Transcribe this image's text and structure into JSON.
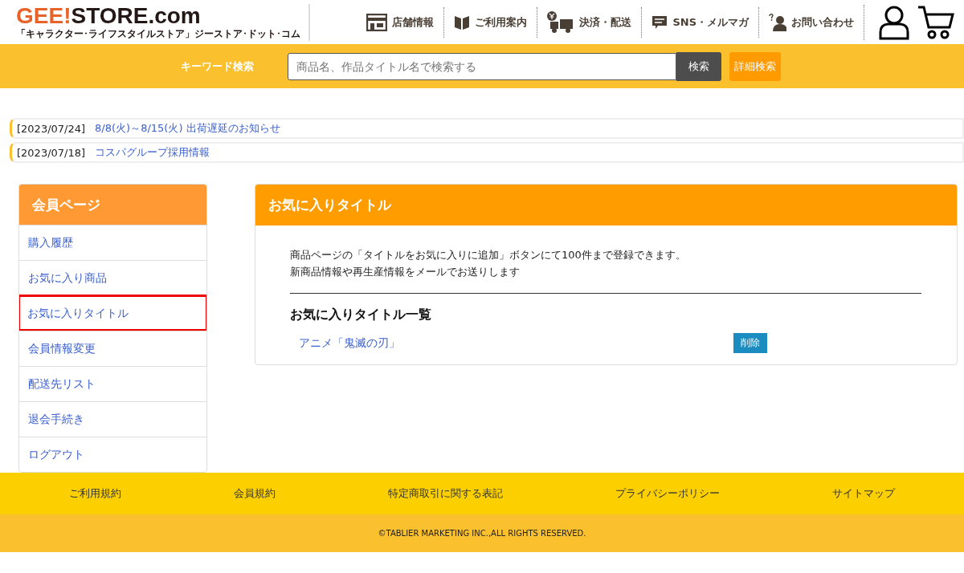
{
  "logo": {
    "accent": "GEE!",
    "main": "STORE.com",
    "tagline": "「キャラクター･ライフスタイルストア」ジーストア･ドット･コム"
  },
  "nav": [
    {
      "label": "店舗情報",
      "kind": "store"
    },
    {
      "label": "ご利用案内",
      "kind": "book"
    },
    {
      "label": "決済・配送",
      "kind": "truck"
    },
    {
      "label": "SNS・メルマガ",
      "kind": "chat"
    },
    {
      "label": "お問い合わせ",
      "kind": "contact"
    }
  ],
  "search": {
    "label": "キーワード検索",
    "placeholder": "商品名、作品タイトル名で検索する",
    "button": "検索",
    "advanced": "詳細検索"
  },
  "news": [
    {
      "date": "[2023/07/24]",
      "title": "8/8(火)～8/15(火) 出荷遅延のお知らせ"
    },
    {
      "date": "[2023/07/18]",
      "title": "コスパグループ採用情報"
    }
  ],
  "sidebar": {
    "title": "会員ページ",
    "items": [
      {
        "label": "購入履歴",
        "selected": false
      },
      {
        "label": "お気に入り商品",
        "selected": false
      },
      {
        "label": "お気に入りタイトル",
        "selected": true
      },
      {
        "label": "会員情報変更",
        "selected": false
      },
      {
        "label": "配送先リスト",
        "selected": false
      },
      {
        "label": "退会手続き",
        "selected": false
      },
      {
        "label": "ログアウト",
        "selected": false
      }
    ]
  },
  "panel": {
    "title": "お気に入りタイトル",
    "description": [
      "商品ページの「タイトルをお気に入りに追加」ボタンにて100件まで登録できます。",
      "新商品情報や再生産情報をメールでお送りします"
    ],
    "list_title": "お気に入りタイトル一覧",
    "items": [
      {
        "title": "アニメ「鬼滅の刃」",
        "action": "削除"
      }
    ]
  },
  "footer": {
    "links": [
      "ご利用規約",
      "会員規約",
      "特定商取引に関する表記",
      "プライバシーポリシー",
      "サイトマップ"
    ],
    "copyright": "©TABLIER MARKETING INC.,ALL RIGHTS RESERVED."
  }
}
